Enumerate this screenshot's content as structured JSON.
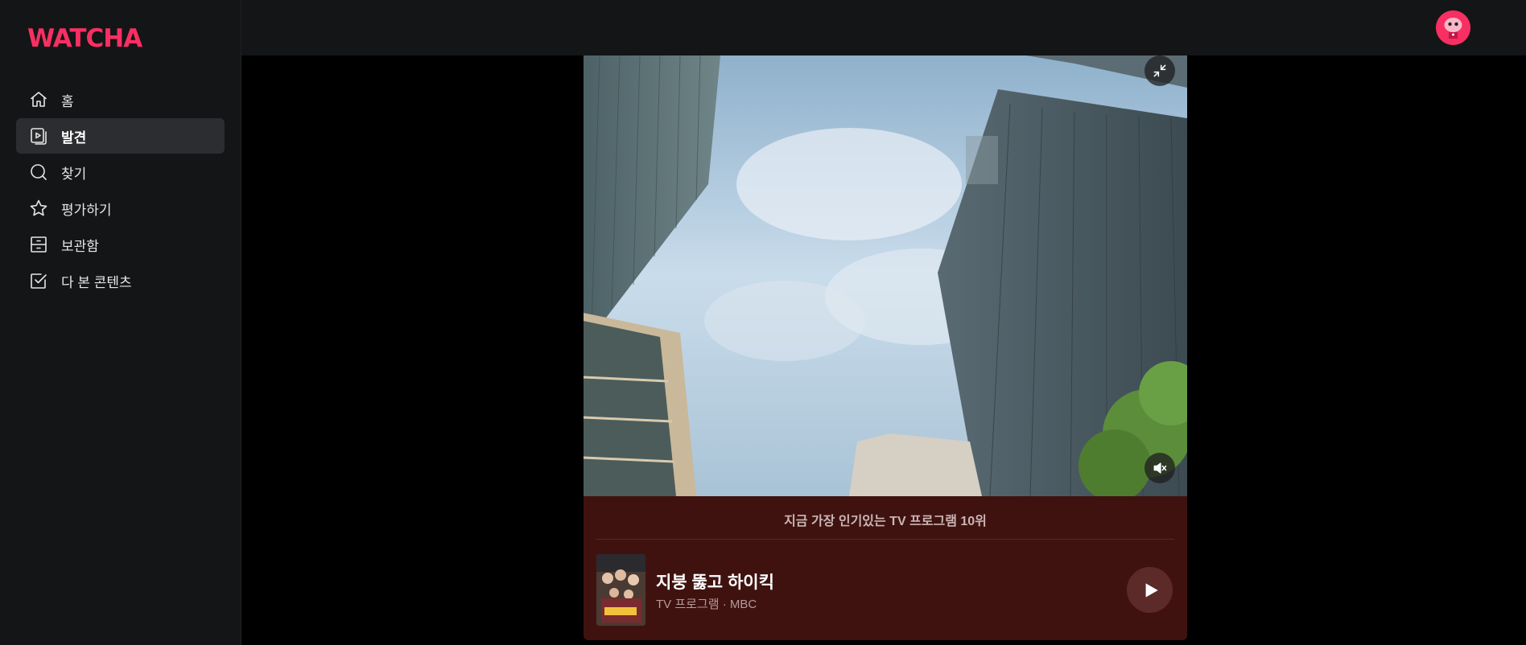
{
  "app": {
    "logo_text": "WATCHA",
    "brand_color": "#f82f62"
  },
  "sidebar": {
    "items": [
      {
        "label": "홈",
        "icon": "home-icon",
        "active": false
      },
      {
        "label": "발견",
        "icon": "discover-icon",
        "active": true
      },
      {
        "label": "찾기",
        "icon": "search-icon",
        "active": false
      },
      {
        "label": "평가하기",
        "icon": "star-icon",
        "active": false
      },
      {
        "label": "보관함",
        "icon": "archive-icon",
        "active": false
      },
      {
        "label": "다 본 콘텐츠",
        "icon": "checkbox-icon",
        "active": false
      }
    ]
  },
  "topbar": {
    "avatar_icon": "profile-avatar-icon"
  },
  "player": {
    "minimize_icon": "minimize-icon",
    "mute_icon": "mute-icon",
    "muted": true
  },
  "info": {
    "rank_text": "지금 가장 인기있는 TV 프로그램 10위",
    "title": "지붕 뚫고 하이킥",
    "meta": "TV 프로그램 · MBC",
    "play_icon": "play-icon",
    "panel_color": "#3f1210"
  }
}
